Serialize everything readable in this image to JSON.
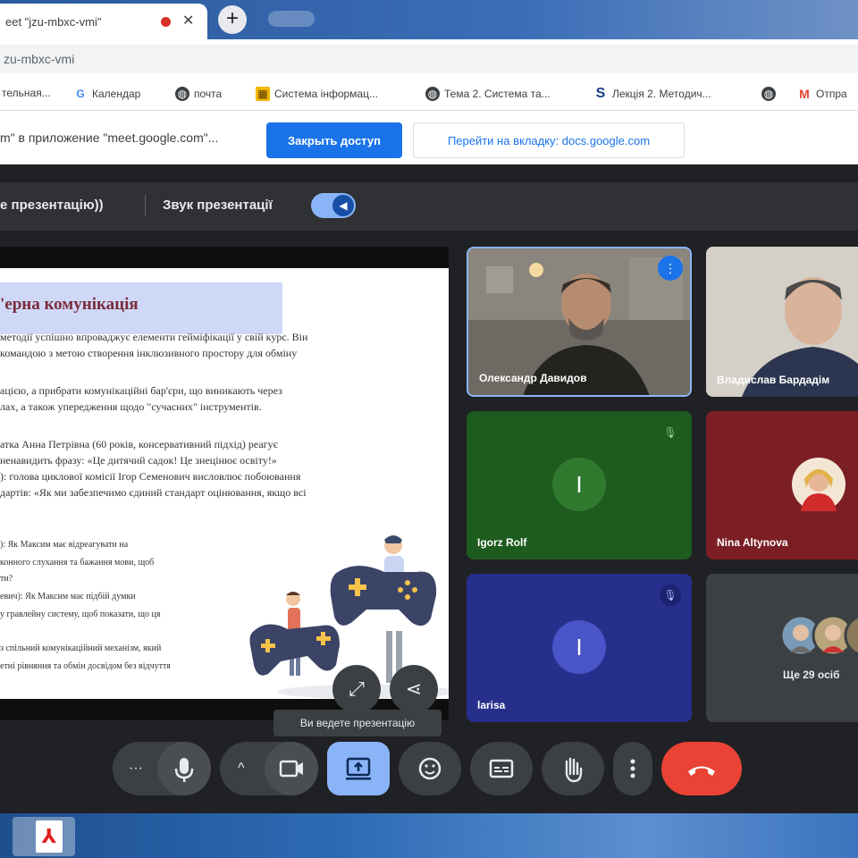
{
  "browser": {
    "tab_title": "eet \"jzu-mbxc-vmi\"",
    "tab_close": "✕",
    "new_tab": "+",
    "second_tab_label": "",
    "url": "zu-mbxc-vmi",
    "bookmarks": [
      {
        "label": "тельная...",
        "icon": "bookmark-icon"
      },
      {
        "label": "Календар",
        "icon": "google-icon"
      },
      {
        "label": "почта",
        "icon": "globe-icon"
      },
      {
        "label": "Система інформац...",
        "icon": "folder-icon"
      },
      {
        "label": "Тема 2. Система та...",
        "icon": "globe-icon"
      },
      {
        "label": "Лекція 2. Методич...",
        "icon": "s-icon"
      },
      {
        "label": "",
        "icon": "globe-icon"
      },
      {
        "label": "Отпра",
        "icon": "gmail-icon"
      }
    ],
    "share_message": "m\" в приложение \"meet.google.com\"...",
    "stop_sharing_label": "Закрыть доступ",
    "goto_tab_label": "Перейти на вкладку: docs.google.com"
  },
  "meet": {
    "presenting_label": "е презентацію))",
    "presentation_sound_label": "Звук презентації",
    "tooltip": "Ви ведете презентацію",
    "tiles": [
      {
        "name": "Олександр Давидов",
        "type": "video"
      },
      {
        "name": "Владислав Бардадім",
        "type": "video"
      },
      {
        "name": "Igorz Rolf",
        "initial": "I",
        "type": "avatar",
        "bg": "#1e5b1e",
        "circle": "#2f7a2f"
      },
      {
        "name": "Nina Altynova",
        "type": "photo",
        "bg": "#7b1f24"
      },
      {
        "name": "larisa",
        "initial": "I",
        "type": "avatar",
        "bg": "#262f8c",
        "circle": "#4854c7"
      },
      {
        "name": "Ще 29 осіб",
        "type": "more",
        "bg": "#3c4043"
      }
    ],
    "controls": {
      "more_dots": "···",
      "chevron": "^"
    }
  },
  "slide": {
    "title": "'ерна комунікація",
    "lines": [
      "методії успішно впроваджує елементи гейміфікації у свій курс. Він",
      "командою з метою створення інклюзивного простору для обміну",
      "",
      "ацією, а прибрати комунікаційні бар'єри, що виникають через",
      "лах, а також упередження щодо \"сучасних\" інструментів.",
      "",
      "атка Анна Петрівна (60 років, консервативний підхід) реагує",
      "ненавидить фразу: «Це дитячий садок! Це знецінює освіту!»",
      "): голова циклової комісії Ігор Семенович висловлює побоювання",
      "дартів: «Як ми забезпечимо єдиний стандарт оцінювання, якщо всі"
    ],
    "lines_small": [
      "): Як Максим має відреагувати на",
      "конного слухання та бажання мови, щоб",
      "ти?",
      "евич): Як Максим має підбій думки",
      "у гравлейну систему, щоб показати, що ця"
    ],
    "lines_bottom": [
      "з спільний комунікаційний механізм, який",
      "етні рівняння та обмін досвідом без відчуття"
    ]
  },
  "colors": {
    "meet_dark": "#202124",
    "accent_blue": "#1a73e8",
    "end_call_red": "#ea4335",
    "present_active": "#8ab4f8"
  }
}
